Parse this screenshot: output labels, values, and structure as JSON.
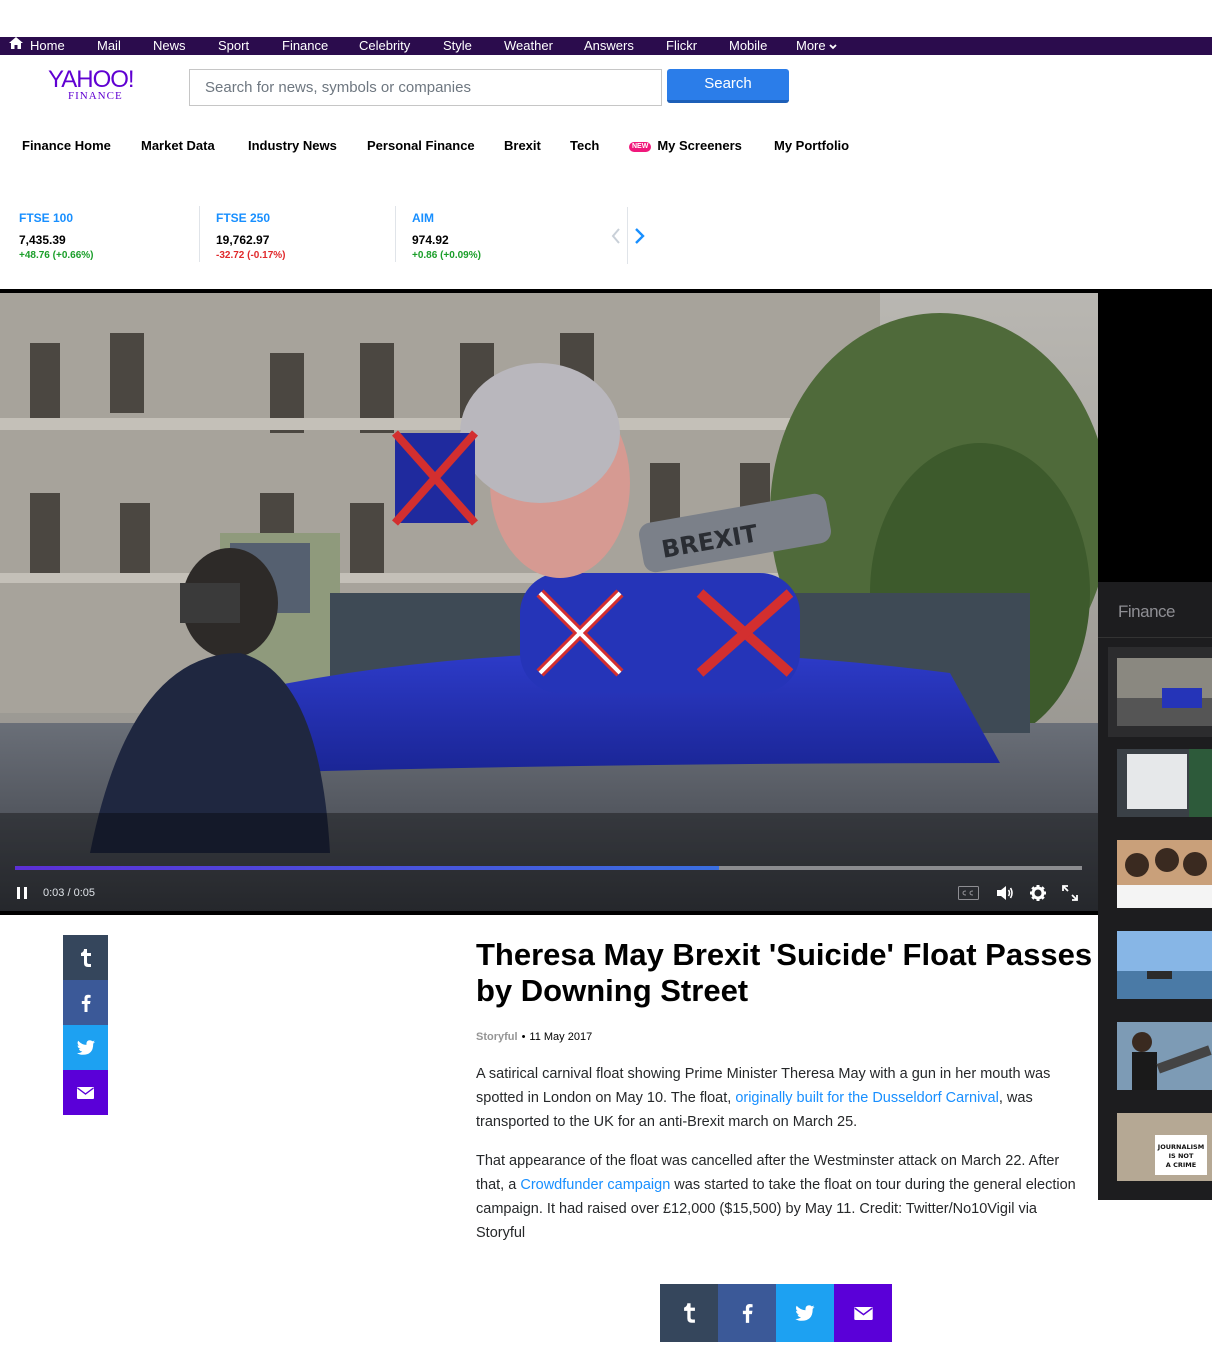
{
  "topnav": {
    "items": [
      "Home",
      "Mail",
      "News",
      "Sport",
      "Finance",
      "Celebrity",
      "Style",
      "Weather",
      "Answers",
      "Flickr",
      "Mobile",
      "More"
    ]
  },
  "header": {
    "logo_main": "YAHOO!",
    "logo_sub": "FINANCE",
    "search_placeholder": "Search for news, symbols or companies",
    "search_button": "Search"
  },
  "subnav": {
    "items": [
      "Finance Home",
      "Market Data",
      "Industry News",
      "Personal Finance",
      "Brexit",
      "Tech",
      "My Screeners",
      "My Portfolio"
    ],
    "new_badge": "NEW"
  },
  "tickers": [
    {
      "name": "FTSE 100",
      "price": "7,435.39",
      "change": "+48.76 (+0.66%)",
      "direction": "up"
    },
    {
      "name": "FTSE 250",
      "price": "19,762.97",
      "change": "-32.72 (-0.17%)",
      "direction": "down"
    },
    {
      "name": "AIM",
      "price": "974.92",
      "change": "+0.86 (+0.09%)",
      "direction": "up"
    }
  ],
  "video": {
    "time": "0:03 / 0:05",
    "progress": 0.66,
    "overlay_text": "BREXIT"
  },
  "playlist": {
    "title": "Finance",
    "thumb_texts": [
      "JOURNALISM IS NOT A CRIME"
    ]
  },
  "article": {
    "headline": "Theresa May Brexit 'Suicide' Float Passes by Downing Street",
    "source": "Storyful",
    "date": "11 May 2017",
    "p1_a": "A satirical carnival float showing Prime Minister Theresa May with a gun in her mouth was spotted in London on May 10. The float, ",
    "p1_link": "originally built for the Dusseldorf Carnival",
    "p1_b": ", was transported to the UK for an anti-Brexit march on March 25.",
    "p2_a": "That appearance of the float was cancelled after the Westminster attack on March 22. After that, a ",
    "p2_link": "Crowdfunder campaign",
    "p2_b": " was started to take the float on tour during the general election campaign. It had raised over £12,000 ($15,500) by May 11. Credit: Twitter/No10Vigil via Storyful"
  },
  "colors": {
    "topbar": "#2b0c4d",
    "brand": "#6001d2",
    "link": "#188fff",
    "up": "#1a9e29",
    "down": "#e0292b",
    "tumblr": "#35465c",
    "facebook": "#3b5998",
    "twitter": "#1da1f2",
    "mail": "#5a00d8"
  }
}
